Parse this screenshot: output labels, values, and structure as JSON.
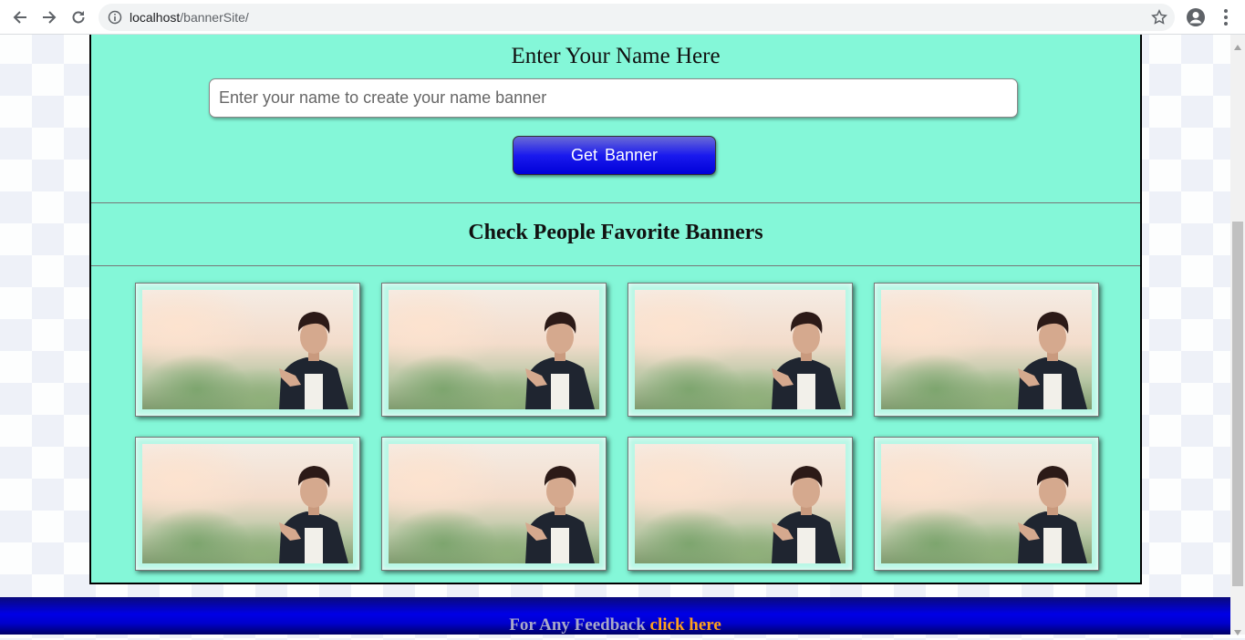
{
  "browser": {
    "url_host": "localhost",
    "url_path": "/bannerSite/"
  },
  "form": {
    "title": "Enter Your Name Here",
    "input_value": "",
    "input_placeholder": "Enter your name to create your name banner",
    "button_label": "Get  Banner"
  },
  "gallery": {
    "title": "Check People Favorite Banners",
    "banner_count": 8
  },
  "footer": {
    "text": "For Any Feedback ",
    "link_label": "click here"
  },
  "colors": {
    "panel_bg": "#84f7d8",
    "button_blue": "#0000e6",
    "footer_link": "#ffa21c"
  }
}
